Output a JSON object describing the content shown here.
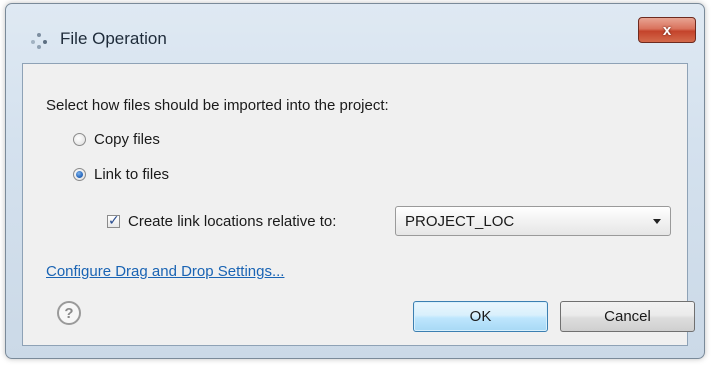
{
  "window": {
    "title": "File Operation",
    "close_label": "x"
  },
  "dialog": {
    "instruction": "Select how files should be imported into the project:",
    "options": [
      {
        "label": "Copy files",
        "selected": false
      },
      {
        "label": "Link to files",
        "selected": true
      }
    ],
    "relative_checkbox": {
      "label": "Create link locations relative to:",
      "checked": true
    },
    "relative_select": {
      "value": "PROJECT_LOC"
    },
    "settings_link": "Configure Drag and Drop Settings...",
    "help_label": "?",
    "ok_label": "OK",
    "cancel_label": "Cancel"
  },
  "colors": {
    "link": "#1a64b4",
    "ok_border": "#3c7fb1",
    "close_button": "#c4432b"
  }
}
